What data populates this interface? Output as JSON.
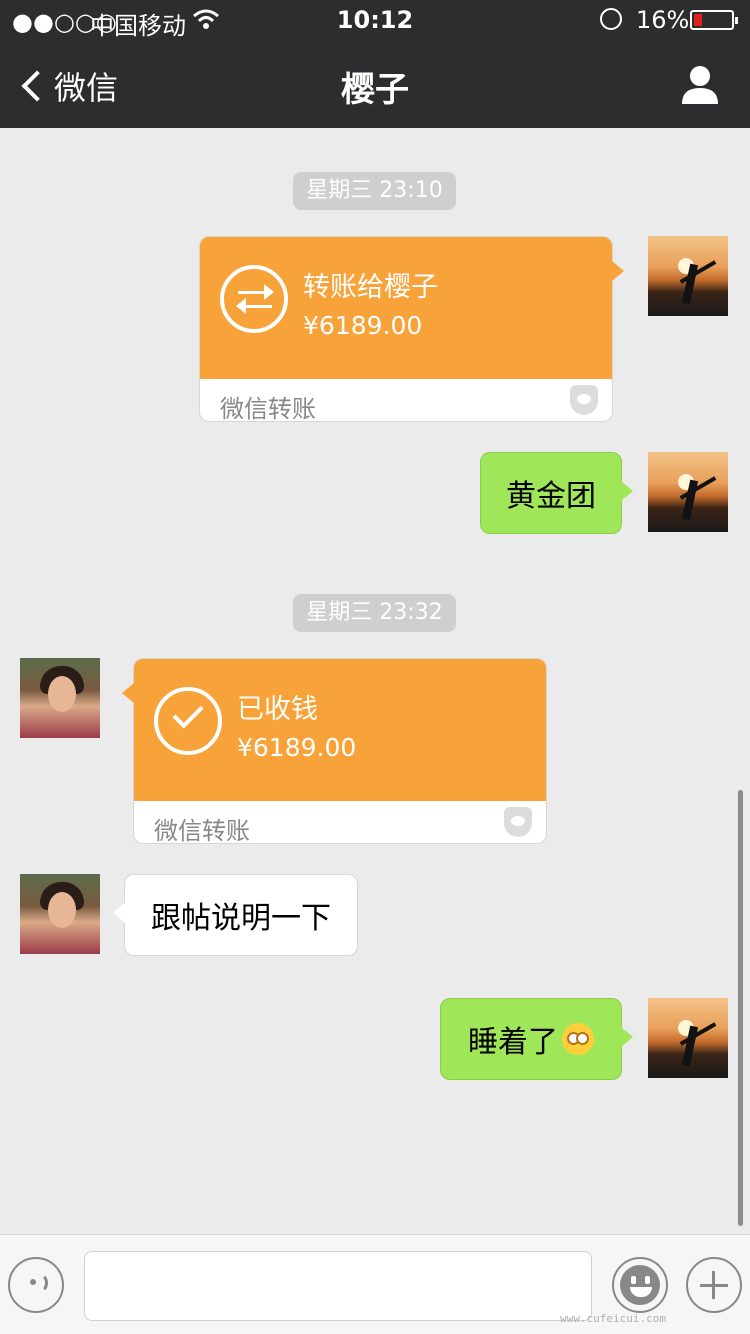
{
  "status_bar": {
    "signal": "●●○○○",
    "carrier": "中国移动",
    "time": "10:12",
    "battery_percent": "16%",
    "battery_level": 0.16
  },
  "nav": {
    "back_label": "微信",
    "title": "樱子"
  },
  "messages": {
    "time1": "星期三 23:10",
    "transfer_sent": {
      "title": "转账给樱子",
      "amount": "¥6189.00",
      "footer": "微信转账"
    },
    "msg1": "黄金团",
    "time2": "星期三 23:32",
    "transfer_received": {
      "title": "已收钱",
      "amount": "¥6189.00",
      "footer": "微信转账"
    },
    "msg2": "跟帖说明一下",
    "msg3": "睡着了"
  },
  "input_bar": {
    "text_value": ""
  },
  "watermark": "www.cufeicui.com",
  "colors": {
    "nav_bg": "#2d2d30",
    "chat_bg": "#ebebeb",
    "my_bubble": "#9fe658",
    "transfer_orange": "#f8a23a"
  }
}
